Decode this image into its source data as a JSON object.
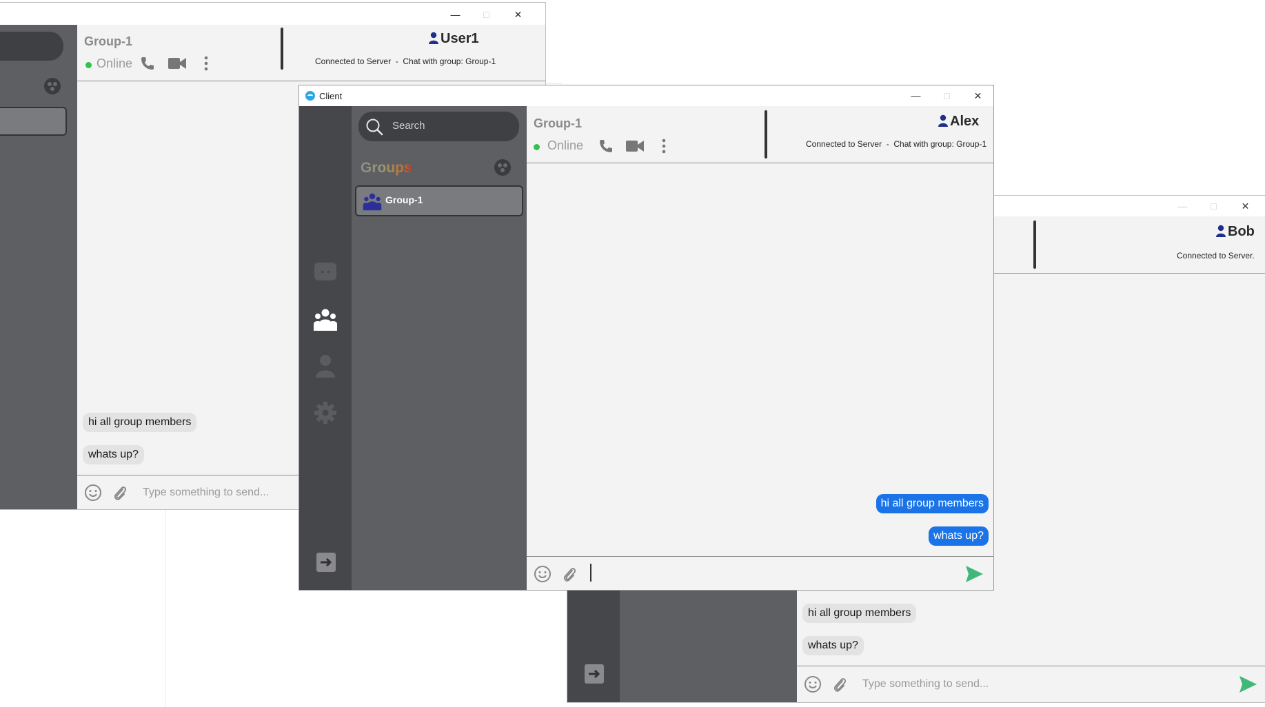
{
  "colors": {
    "rail": "#46474a",
    "sidebar": "#5e5f62",
    "chat_bg": "#f3f3f3",
    "accent_blue": "#1a74e8",
    "online_green": "#33c24d",
    "send_green": "#3fb97a",
    "user_icon_blue": "#1f2f8a"
  },
  "window_back": {
    "group_title": "Group-1",
    "status": "Online",
    "user_name": "User1",
    "connection": "Connected to Server  -  Chat with group: Group-1",
    "messages": [
      "hi all group members",
      "whats up?"
    ],
    "composer_placeholder": "Type something to send..."
  },
  "window_bob": {
    "user_name": "Bob",
    "connection": "Connected to Server.",
    "messages": [
      "hi all group members",
      "whats up?"
    ],
    "composer_placeholder": "Type something to send..."
  },
  "window_front": {
    "title": "Client",
    "search_placeholder": "Search",
    "groups_heading": "Groups",
    "groups": [
      {
        "label": "Group-1"
      }
    ],
    "group_title": "Group-1",
    "status": "Online",
    "user_name": "Alex",
    "connection": "Connected to Server  -  Chat with group: Group-1",
    "messages": [
      "hi all group members",
      "whats up?"
    ],
    "nav_icons": [
      "chat-icon",
      "groups-icon",
      "profile-icon",
      "settings-icon",
      "logout-icon"
    ]
  }
}
